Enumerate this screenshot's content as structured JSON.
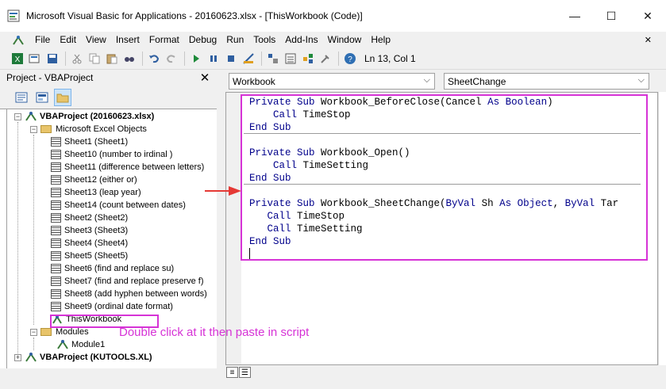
{
  "window": {
    "title": "Microsoft Visual Basic for Applications - 20160623.xlsx - [ThisWorkbook (Code)]",
    "minimize": "—",
    "maximize": "☐",
    "close": "✕"
  },
  "menu": {
    "items": [
      "File",
      "Edit",
      "View",
      "Insert",
      "Format",
      "Debug",
      "Run",
      "Tools",
      "Add-Ins",
      "Window",
      "Help"
    ],
    "close_doc": "✕"
  },
  "toolbar": {
    "position": "Ln 13, Col 1",
    "icons": [
      "excel-icon",
      "insert-icon",
      "save-icon",
      "cut-icon",
      "copy-icon",
      "paste-icon",
      "find-icon",
      "undo-icon",
      "redo-icon",
      "run-icon",
      "break-icon",
      "reset-icon",
      "design-mode-icon",
      "project-explorer-icon",
      "properties-icon",
      "object-browser-icon",
      "toolbox-icon",
      "help-icon"
    ]
  },
  "project": {
    "header": "Project - VBAProject",
    "close": "✕",
    "tree": {
      "root1": "VBAProject (20160623.xlsx)",
      "objects_folder": "Microsoft Excel Objects",
      "sheets": [
        "Sheet1 (Sheet1)",
        "Sheet10 (number to irdinal )",
        "Sheet11 (difference between letters)",
        "Sheet12 (either or)",
        "Sheet13 (leap year)",
        "Sheet14 (count between dates)",
        "Sheet2 (Sheet2)",
        "Sheet3 (Sheet3)",
        "Sheet4 (Sheet4)",
        "Sheet5 (Sheet5)",
        "Sheet6 (find and replace su)",
        "Sheet7 (find and replace preserve f)",
        "Sheet8 (add hyphen between words)",
        "Sheet9 (ordinal date format)"
      ],
      "this_workbook": "ThisWorkbook",
      "modules_folder": "Modules",
      "module1": "Module1",
      "root2": "VBAProject (KUTOOLS.XL)"
    }
  },
  "code": {
    "object_combo": "Workbook",
    "procedure_combo": "SheetChange",
    "blocks": [
      [
        [
          {
            "t": "Private Sub ",
            "k": true
          },
          {
            "t": "Workbook_BeforeClose(Cancel ",
            "k": false
          },
          {
            "t": "As Boolean",
            "k": true
          },
          {
            "t": ")",
            "k": false
          }
        ],
        [
          {
            "t": "    Call ",
            "k": true
          },
          {
            "t": "TimeStop",
            "k": false
          }
        ],
        [
          {
            "t": "End Sub",
            "k": true
          }
        ]
      ],
      [
        [
          {
            "t": "Private Sub ",
            "k": true
          },
          {
            "t": "Workbook_Open()",
            "k": false
          }
        ],
        [
          {
            "t": "    Call ",
            "k": true
          },
          {
            "t": "TimeSetting",
            "k": false
          }
        ],
        [
          {
            "t": "End Sub",
            "k": true
          }
        ]
      ],
      [
        [
          {
            "t": "Private Sub ",
            "k": true
          },
          {
            "t": "Workbook_SheetChange(",
            "k": false
          },
          {
            "t": "ByVal ",
            "k": true
          },
          {
            "t": "Sh ",
            "k": false
          },
          {
            "t": "As Object",
            "k": true
          },
          {
            "t": ", ",
            "k": false
          },
          {
            "t": "ByVal ",
            "k": true
          },
          {
            "t": "Tar",
            "k": false
          }
        ],
        [
          {
            "t": "   Call ",
            "k": true
          },
          {
            "t": "TimeStop",
            "k": false
          }
        ],
        [
          {
            "t": "   Call ",
            "k": true
          },
          {
            "t": "TimeSetting",
            "k": false
          }
        ],
        [
          {
            "t": "End Sub",
            "k": true
          }
        ]
      ]
    ]
  },
  "annotation": {
    "text": "Double click at it then paste in script",
    "color": "#d633d6",
    "arrow_color": "#e53935"
  }
}
